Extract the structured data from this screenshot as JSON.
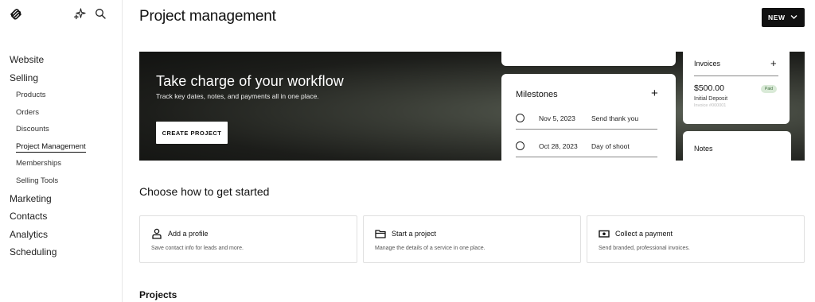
{
  "header": {
    "title": "Project management",
    "new_label": "NEW"
  },
  "icons": {
    "logo": "squarespace-logo-icon",
    "spark": "sparkle-icon",
    "search": "search-icon",
    "new_caret": "chevron-down-icon",
    "milestone_add": "plus-icon",
    "invoice_add": "plus-icon",
    "profile": "person-icon",
    "project": "folder-icon",
    "payment": "cash-icon"
  },
  "sidebar": {
    "sections": [
      {
        "label": "Website"
      },
      {
        "label": "Selling",
        "children": [
          {
            "label": "Products"
          },
          {
            "label": "Orders"
          },
          {
            "label": "Discounts"
          },
          {
            "label": "Project Management",
            "active": true
          },
          {
            "label": "Memberships"
          },
          {
            "label": "Selling Tools"
          }
        ]
      },
      {
        "label": "Marketing"
      },
      {
        "label": "Contacts"
      },
      {
        "label": "Analytics"
      },
      {
        "label": "Scheduling"
      }
    ]
  },
  "hero": {
    "title": "Take charge of your workflow",
    "subtitle": "Track key dates, notes, and payments all in one place.",
    "cta": "CREATE PROJECT",
    "milestones": {
      "title": "Milestones",
      "plus": "+",
      "rows": [
        {
          "date": "Nov 5, 2023",
          "label": "Send thank you"
        },
        {
          "date": "Oct 28, 2023",
          "label": "Day of shoot"
        }
      ]
    },
    "invoices": {
      "title": "Invoices",
      "plus": "+",
      "amount": "$500.00",
      "badge": "Paid",
      "description": "Initial Deposit",
      "number": "Invoice #000001"
    },
    "notes": {
      "title": "Notes"
    }
  },
  "choose": {
    "title": "Choose how to get started",
    "options": [
      {
        "title": "Add a profile",
        "desc": "Save contact info for leads and more."
      },
      {
        "title": "Start a project",
        "desc": "Manage the details of a service in one place."
      },
      {
        "title": "Collect a payment",
        "desc": "Send branded, professional invoices."
      }
    ]
  },
  "projects": {
    "title": "Projects"
  }
}
